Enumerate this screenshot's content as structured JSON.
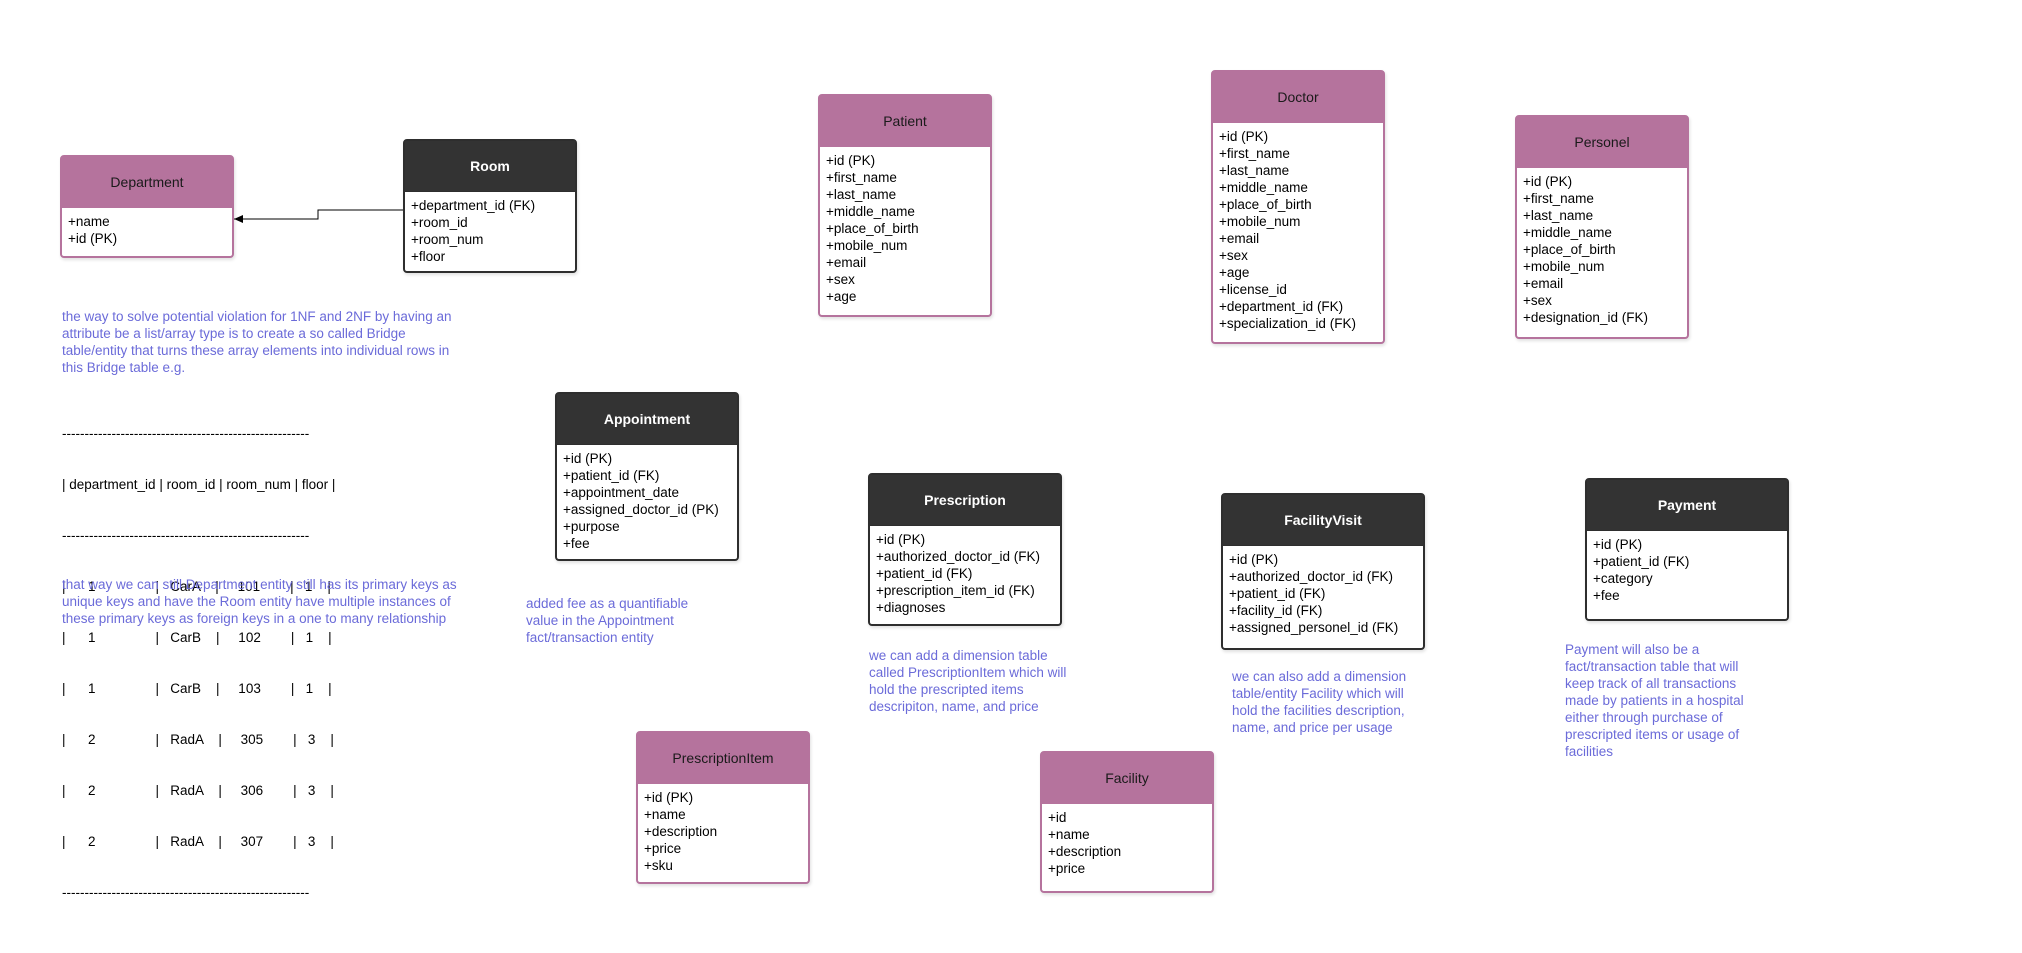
{
  "entities": {
    "department": {
      "title": "Department",
      "attributes": [
        "+name",
        "+id (PK)"
      ]
    },
    "room": {
      "title": "Room",
      "attributes": [
        "+department_id (FK)",
        "+room_id",
        "+room_num",
        "+floor"
      ]
    },
    "patient": {
      "title": "Patient",
      "attributes": [
        "+id (PK)",
        "+first_name",
        "+last_name",
        "+middle_name",
        "+place_of_birth",
        "+mobile_num",
        "+email",
        "+sex",
        "+age"
      ]
    },
    "doctor": {
      "title": "Doctor",
      "attributes": [
        "+id (PK)",
        "+first_name",
        "+last_name",
        "+middle_name",
        "+place_of_birth",
        "+mobile_num",
        "+email",
        "+sex",
        "+age",
        "+license_id",
        "+department_id (FK)",
        "+specialization_id (FK)"
      ]
    },
    "personel": {
      "title": "Personel",
      "attributes": [
        "+id (PK)",
        "+first_name",
        "+last_name",
        "+middle_name",
        "+place_of_birth",
        "+mobile_num",
        "+email",
        "+sex",
        "+designation_id (FK)"
      ]
    },
    "appointment": {
      "title": "Appointment",
      "attributes": [
        "+id (PK)",
        "+patient_id (FK)",
        "+appointment_date",
        "+assigned_doctor_id (PK)",
        "+purpose",
        "+fee"
      ]
    },
    "prescription": {
      "title": "Prescription",
      "attributes": [
        "+id (PK)",
        "+authorized_doctor_id (FK)",
        "+patient_id (FK)",
        "+prescription_item_id (FK)",
        "+diagnoses"
      ]
    },
    "facility_visit": {
      "title": "FacilityVisit",
      "attributes": [
        "+id (PK)",
        "+authorized_doctor_id (FK)",
        "+patient_id (FK)",
        "+facility_id (FK)",
        "+assigned_personel_id (FK)"
      ]
    },
    "payment": {
      "title": "Payment",
      "attributes": [
        "+id (PK)",
        "+patient_id (FK)",
        "+category",
        "+fee"
      ]
    },
    "prescription_item": {
      "title": "PrescriptionItem",
      "attributes": [
        "+id (PK)",
        "+name",
        "+description",
        "+price",
        "+sku"
      ]
    },
    "facility": {
      "title": "Facility",
      "attributes": [
        "+id",
        "+name",
        "+description",
        "+price"
      ]
    }
  },
  "notes": {
    "bridge_intro": "the way to solve potential violation for 1NF and 2NF by having an attribute be a list/array type is to create a so called Bridge table/entity that turns these array elements into individual rows in this Bridge table e.g.",
    "bridge_outro": "that way we can still Department entity still has its primary keys as unique keys and have the Room entity have multiple instances of these primary keys as foreign keys in a one to many relationship",
    "appointment_fee": "added  fee as a quantifiable value in the Appointment fact/transaction entity",
    "prescription_item": "we can add a dimension table called PrescriptionItem which will hold the prescripted items descripiton, name, and price",
    "facility": "we can also add a dimension table/entity Facility which will hold the facilities description, name, and price per usage",
    "payment": "Payment will also be a fact/transaction table that will keep track of all transactions made by patients in a hospital either through purchase of prescripted items or usage of facilities"
  },
  "bridge_table": {
    "rule": "-------------------------------------------------------",
    "header": "| department_id | room_id | room_num | floor |",
    "rows": [
      "|      1                |   CarA    |     101        |   1    |",
      "|      1                |   CarB    |     102        |   1    |",
      "|      1                |   CarB    |     103        |   1    |",
      "|      2                |   RadA    |     305        |   3    |",
      "|      2                |   RadA    |     306        |   3    |",
      "|      2                |   RadA    |     307        |   3    |"
    ]
  },
  "colors": {
    "entity_pink": "#b5739d",
    "entity_dark": "#333333",
    "note_text": "#6b6bd9"
  }
}
